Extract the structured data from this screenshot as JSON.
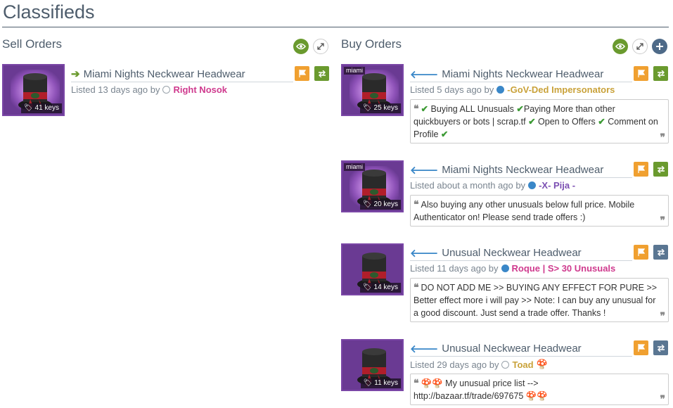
{
  "page": {
    "title": "Classifieds"
  },
  "sell": {
    "title": "Sell Orders",
    "listings": [
      {
        "item": "Miami Nights Neckwear Headwear",
        "price": "41 keys",
        "listed": "Listed 13 days ago by",
        "user": "Right Nosok",
        "user_color": "#cf3a8e",
        "online": false
      }
    ]
  },
  "buy": {
    "title": "Buy Orders",
    "listings": [
      {
        "item": "Miami Nights Neckwear Headwear",
        "effect": "miami",
        "price": "25 keys",
        "listed": "Listed 5 days ago by",
        "user": "-GoV-Ded Impersonators",
        "user_color": "#c9a23a",
        "online": true,
        "message": [
          "Buying ALL Unusuals",
          "Paying More than other quickbuyers or bots | scrap.tf",
          "Open to Offers",
          "Comment on Profile"
        ]
      },
      {
        "item": "Miami Nights Neckwear Headwear",
        "effect": "miami",
        "price": "20 keys",
        "listed": "Listed about a month ago by",
        "user": "-X- Pija -",
        "user_color": "#7b4fb2",
        "online": true,
        "message": "Also buying any other unusuals below full price. Mobile Authenticator on! Please send trade offers :)"
      },
      {
        "item": "Unusual Neckwear Headwear",
        "price": "14 keys",
        "listed": "Listed 11 days ago by",
        "user": "Roque | S> 30 Unusuals",
        "user_color": "#cf3a8e",
        "online": true,
        "message": "DO NOT ADD ME >> BUYING ANY EFFECT FOR PURE >> Better effect more i will pay >> Note: I can buy any unusual for a good discount. Just send a trade offer. Thanks !"
      },
      {
        "item": "Unusual Neckwear Headwear",
        "price": "11 keys",
        "listed": "Listed 29 days ago by",
        "user": "Toad",
        "user_color": "#c9a23a",
        "online": false,
        "message_a": "My unusual price list -->",
        "message_b": "http://bazaar.tf/trade/697675"
      }
    ]
  },
  "colors": {
    "accent_green": "#6a9a2e",
    "accent_orange": "#f0a030",
    "accent_slate": "#5a7692",
    "unusual_purple": "#6a3a93"
  }
}
